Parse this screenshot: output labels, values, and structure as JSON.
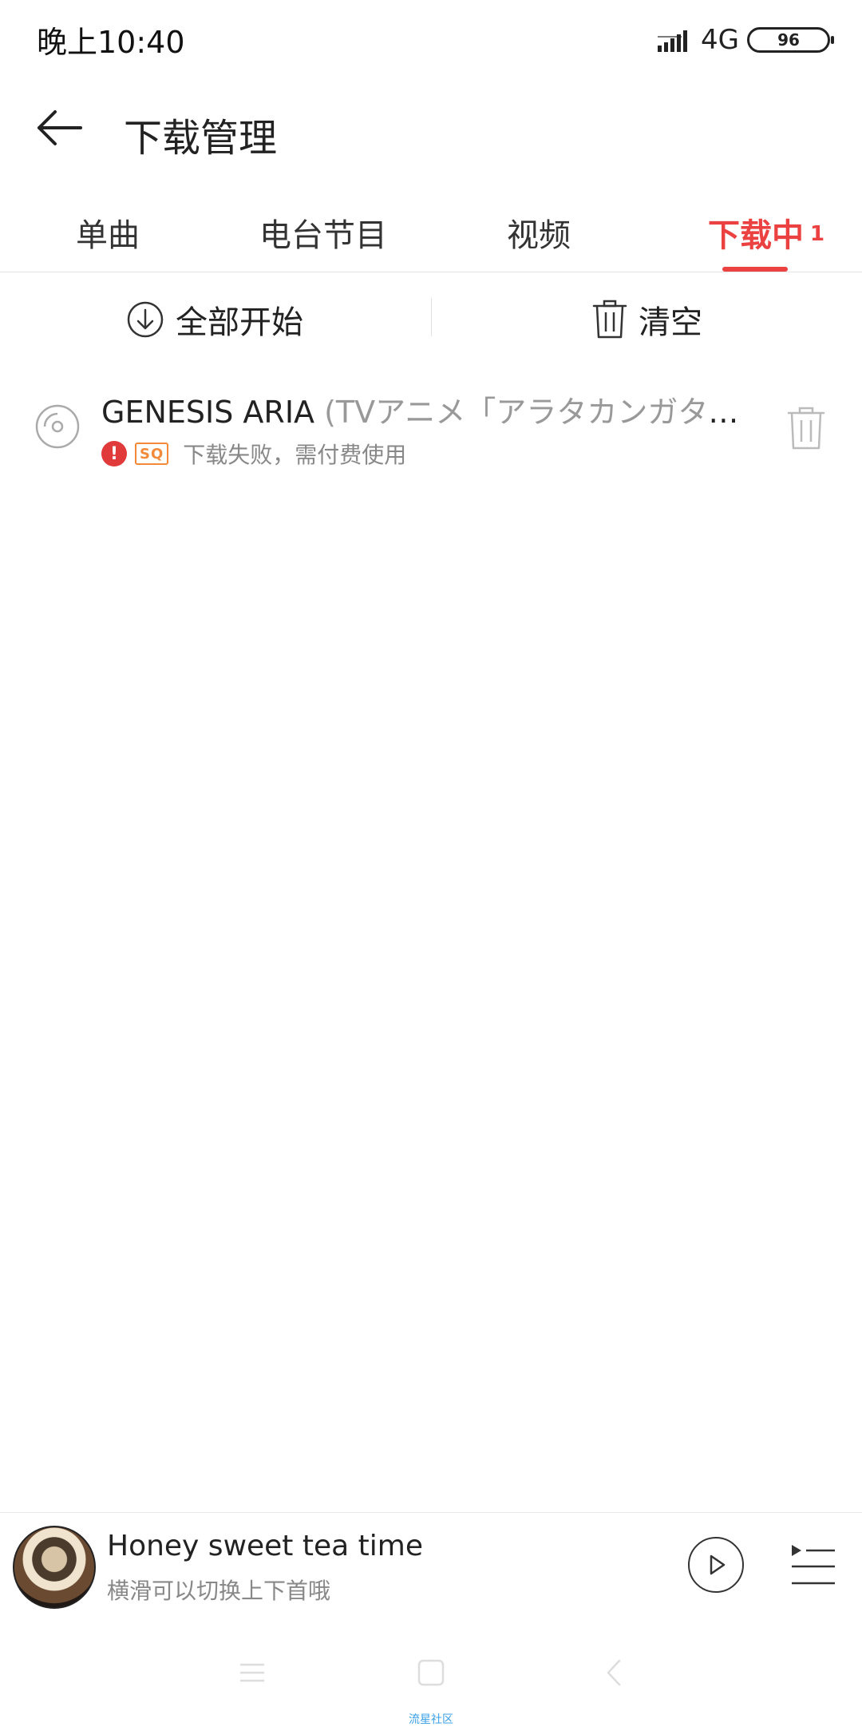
{
  "status_bar": {
    "time": "晚上10:40",
    "network": "4G",
    "battery": "96"
  },
  "header": {
    "title": "下载管理",
    "back_icon": "arrow-left-icon"
  },
  "tabs": [
    {
      "label": "单曲",
      "active": false
    },
    {
      "label": "电台节目",
      "active": false
    },
    {
      "label": "视频",
      "active": false
    },
    {
      "label": "下载中",
      "count": "1",
      "active": true
    }
  ],
  "toolbar": {
    "start_all": "全部开始",
    "clear": "清空"
  },
  "downloads": [
    {
      "title": "GENESIS ARIA",
      "subtitle": " (TVアニメ「アラタカンガタリ～革神語～」OPテーマ)",
      "quality_badge": "SQ",
      "status": "下载失败，需付费使用"
    }
  ],
  "player": {
    "title": "Honey sweet tea time",
    "subtitle": "横滑可以切换上下首哦"
  },
  "watermark": "流星社区",
  "colors": {
    "accent": "#ec4141",
    "error": "#e03a3a",
    "sq_badge": "#f28a3a"
  }
}
